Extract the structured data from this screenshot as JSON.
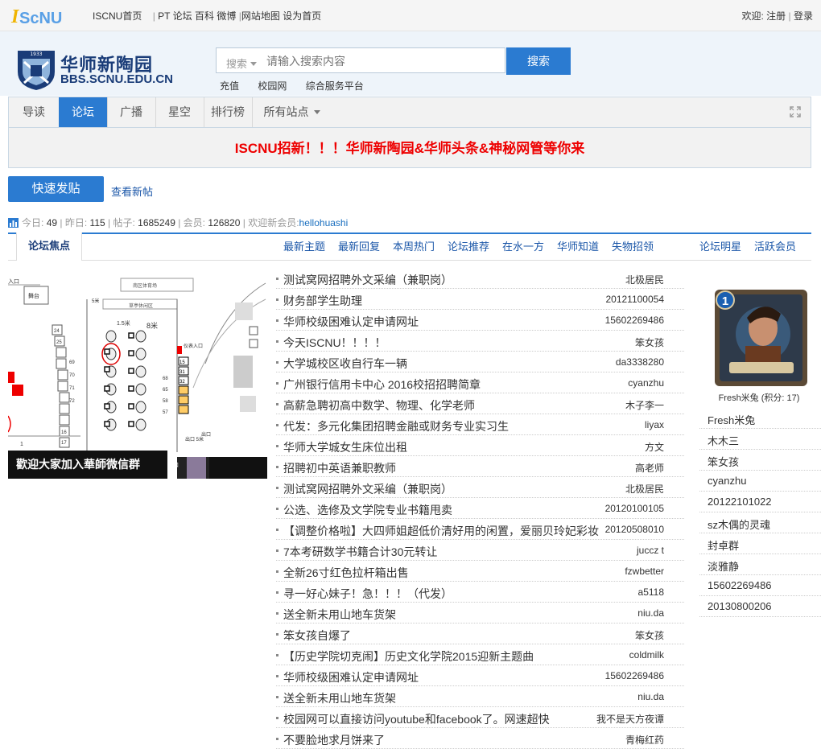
{
  "topbar": {
    "logo_text": "IScNU",
    "links": [
      "ISCNU首页",
      "|",
      "PT",
      "论坛",
      "百科",
      "微博",
      "|",
      "网站地图",
      "设为首页"
    ],
    "welcome": "欢迎:",
    "register": "注册",
    "sep": "|",
    "login": "登录"
  },
  "header": {
    "crest_year": "1933",
    "site_name": "华师新陶园",
    "site_url": "BBS.SCNU.EDU.CN"
  },
  "search": {
    "type_label": "搜索",
    "placeholder": "请输入搜索内容",
    "button": "搜索",
    "quicklinks": [
      "充值",
      "校园网",
      "综合服务平台"
    ]
  },
  "nav": {
    "items": [
      "导读",
      "论坛",
      "广播",
      "星空",
      "排行榜",
      "所有站点"
    ],
    "active": "论坛"
  },
  "banner": "ISCNU招新！！！华师新陶园&华师头条&神秘网管等你来",
  "actions": {
    "post_button": "快速发贴",
    "new_posts_link": "查看新帖"
  },
  "stats": {
    "today_label": "今日:",
    "today": "49",
    "yesterday_label": "昨日:",
    "yesterday": "115",
    "posts_label": "帖子:",
    "posts": "1685249",
    "members_label": "会员:",
    "members": "126820",
    "welcome_label": "欢迎新会员:",
    "new_member": "hellohuashi"
  },
  "tabs": {
    "focus": "论坛焦点",
    "items": [
      "最新主题",
      "最新回复",
      "本周热门",
      "论坛推荐",
      "在水一方",
      "华师知道",
      "失物招领"
    ],
    "right": [
      "论坛明星",
      "活跃会员"
    ]
  },
  "focus": {
    "caption": "歡迎大家加入華師微信群",
    "map_labels": [
      "入口",
      "舞台",
      "南区体育场",
      "草亭休闲区",
      "1.5米",
      "8米",
      "5米",
      "24",
      "25",
      "15",
      "31",
      "32",
      "68",
      "65",
      "58",
      "57",
      "69",
      "70",
      "71",
      "72",
      "17",
      "16",
      "1",
      "入口",
      "出口",
      "仪表入口",
      "出口 5米"
    ]
  },
  "threads": [
    {
      "title": "测试窝网招聘外文采编（兼职岗）",
      "author": "北极居民"
    },
    {
      "title": "财务部学生助理",
      "author": "20121100054"
    },
    {
      "title": "华师校级困难认定申请网址",
      "author": "15602269486"
    },
    {
      "title": "今天ISCNU！！！！",
      "author": "笨女孩"
    },
    {
      "title": "大学城校区收自行车一辆",
      "author": "da3338280"
    },
    {
      "title": "广州银行信用卡中心 2016校招招聘简章",
      "author": "cyanzhu"
    },
    {
      "title": "高薪急聘初高中数学、物理、化学老师",
      "author": "木子李一"
    },
    {
      "title": "代发：多元化集团招聘金融或财务专业实习生",
      "author": "liyax"
    },
    {
      "title": "华师大学城女生床位出租",
      "author": "方文"
    },
    {
      "title": "招聘初中英语兼职教师",
      "author": "高老师"
    },
    {
      "title": "测试窝网招聘外文采编（兼职岗）",
      "author": "北极居民"
    },
    {
      "title": "公选、选修及文学院专业书籍甩卖",
      "author": "20120100105"
    },
    {
      "title": "【调整价格啦】大四师姐超低价清好用的闲置，爱丽贝玲妃彩妆",
      "author": "20120508010"
    },
    {
      "title": "7本考研数学书籍合计30元转让",
      "author": "juccz t"
    },
    {
      "title": "全新26寸红色拉杆箱出售",
      "author": "fzwbetter"
    },
    {
      "title": "寻一好心妹子！急！！！（代发）",
      "author": "a5118"
    },
    {
      "title": "送全新未用山地车货架",
      "author": "niu.da"
    },
    {
      "title": "笨女孩自爆了",
      "author": "笨女孩"
    },
    {
      "title": "【历史学院切克闹】历史文化学院2015迎新主题曲",
      "author": "coldmilk"
    },
    {
      "title": "华师校级困难认定申请网址",
      "author": "15602269486"
    },
    {
      "title": "送全新未用山地车货架",
      "author": "niu.da"
    },
    {
      "title": "校园网可以直接访问youtube和facebook了。网速超快",
      "author": "我不是天方夜谭"
    },
    {
      "title": "不要脸地求月饼来了",
      "author": "青梅红药"
    }
  ],
  "star": {
    "card_number": "1",
    "name": "Fresh米兔 (积分: 17)"
  },
  "members": [
    "Fresh米兔",
    "木木三",
    "笨女孩",
    "cyanzhu",
    "20122101022",
    "sz木偶的灵魂",
    "封卓群",
    "淡雅静",
    "15602269486",
    "20130800206"
  ],
  "colors": {
    "accent": "#2b7bd1",
    "banner_text": "#ee0000",
    "brand": "#1a3c78"
  }
}
